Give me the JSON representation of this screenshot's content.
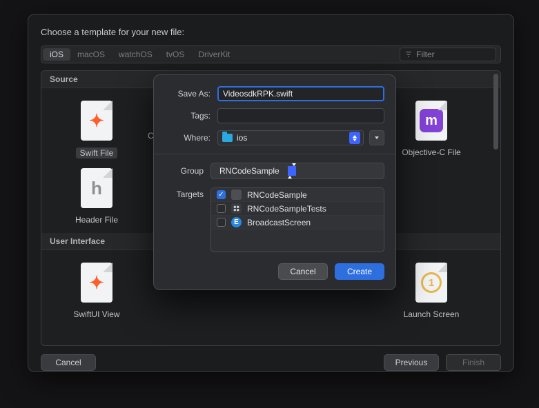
{
  "back_dialog": {
    "title": "Choose a template for your new file:",
    "tabs": [
      "iOS",
      "macOS",
      "watchOS",
      "tvOS",
      "DriverKit"
    ],
    "active_tab": "iOS",
    "filter_placeholder": "Filter",
    "sections": {
      "source": {
        "header": "Source",
        "row1": {
          "swift": "Swift File",
          "objc": "Objective-C File"
        },
        "row2": {
          "header": "Header File"
        }
      },
      "ui": {
        "header": "User Interface",
        "swiftui": "SwiftUI View",
        "launch": "Launch Screen"
      }
    },
    "buttons": {
      "cancel": "Cancel",
      "previous": "Previous",
      "finish": "Finish"
    }
  },
  "peek_item_label": "C",
  "sheet": {
    "save_as_label": "Save As:",
    "save_as_value": "VideosdkRPK.swift",
    "tags_label": "Tags:",
    "tags_value": "",
    "where_label": "Where:",
    "where_value": "ios",
    "group_label": "Group",
    "group_value": "RNCodeSample",
    "targets_label": "Targets",
    "targets": [
      {
        "name": "RNCodeSample",
        "checked": true,
        "kind": "app"
      },
      {
        "name": "RNCodeSampleTests",
        "checked": false,
        "kind": "tests"
      },
      {
        "name": "BroadcastScreen",
        "checked": false,
        "kind": "ext",
        "badge": "E"
      }
    ],
    "buttons": {
      "cancel": "Cancel",
      "create": "Create"
    }
  }
}
